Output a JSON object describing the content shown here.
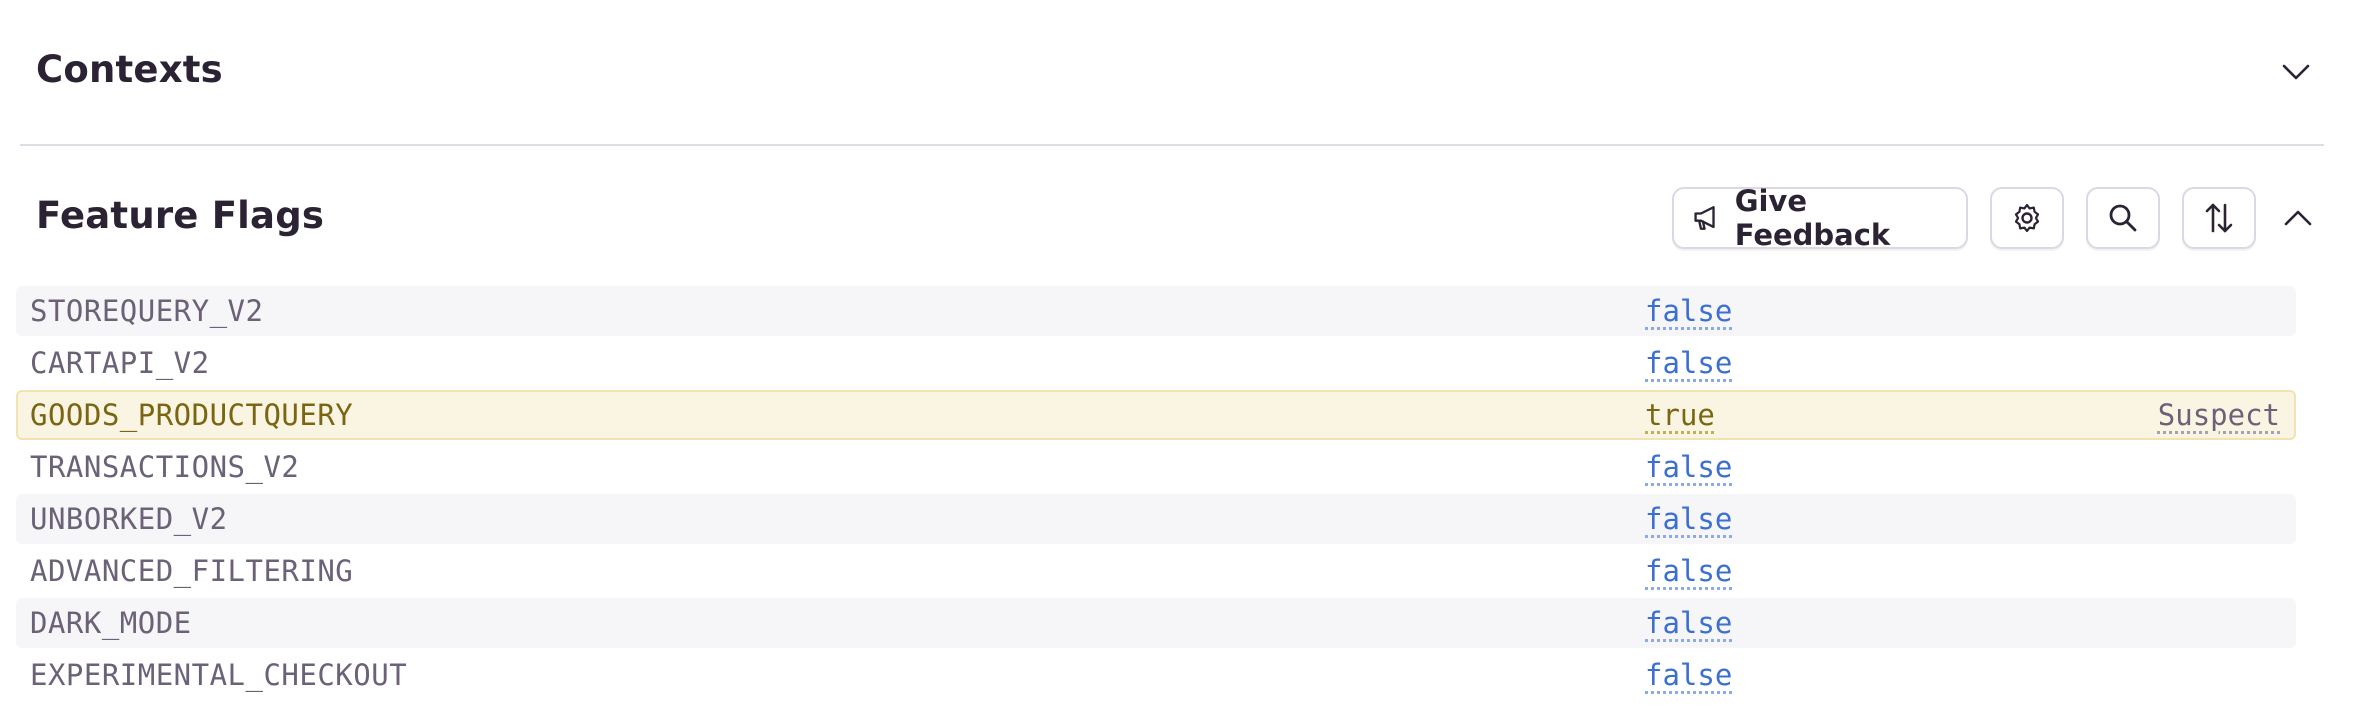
{
  "contexts": {
    "title": "Contexts",
    "toggle_icon": "chevron-down-icon"
  },
  "feature_flags": {
    "title": "Feature Flags",
    "toolbar": {
      "feedback_label": "Give Feedback",
      "feedback_icon": "megaphone-icon",
      "settings_icon": "gear-icon",
      "search_icon": "search-icon",
      "sort_icon": "sort-arrows-icon",
      "collapse_icon": "chevron-up-icon"
    },
    "flags": [
      {
        "name": "STOREQUERY_V2",
        "value": "false",
        "badge": ""
      },
      {
        "name": "CARTAPI_V2",
        "value": "false",
        "badge": ""
      },
      {
        "name": "GOODS_PRODUCTQUERY",
        "value": "true",
        "badge": "Suspect"
      },
      {
        "name": "TRANSACTIONS_V2",
        "value": "false",
        "badge": ""
      },
      {
        "name": "UNBORKED_V2",
        "value": "false",
        "badge": ""
      },
      {
        "name": "ADVANCED_FILTERING",
        "value": "false",
        "badge": ""
      },
      {
        "name": "DARK_MODE",
        "value": "false",
        "badge": ""
      },
      {
        "name": "EXPERIMENTAL_CHECKOUT",
        "value": "false",
        "badge": ""
      }
    ]
  },
  "colors": {
    "text_primary": "#2b2233",
    "flag_name": "#6b6278",
    "flag_value_link": "#3b6fd0",
    "suspect_background": "#faf5e3",
    "suspect_text": "#7a6612",
    "row_alt_background": "#f6f5f8"
  }
}
